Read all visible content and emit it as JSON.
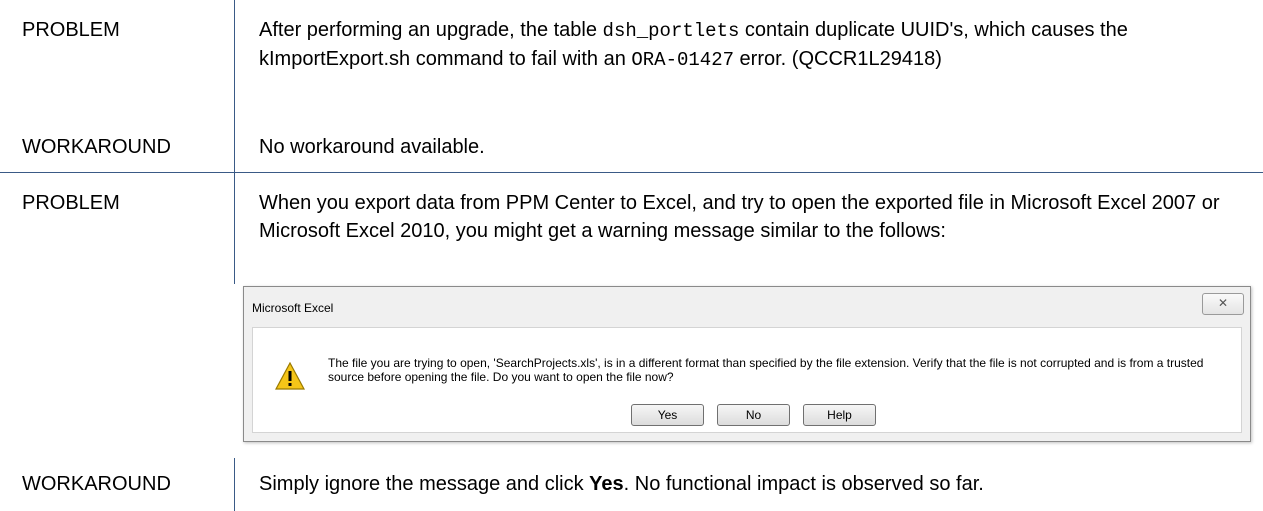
{
  "rows": [
    {
      "problem_label": "PROBLEM",
      "problem_text_1": "After performing an upgrade, the table ",
      "problem_code_1": "dsh_portlets",
      "problem_text_2": " contain duplicate UUID's, which causes the kImportExport.sh command to fail with an ",
      "problem_code_2": "ORA-01427",
      "problem_text_3": " error. (QCCR1L29418)",
      "workaround_label": "WORKAROUND",
      "workaround_text": "No workaround available."
    },
    {
      "problem_label": "PROBLEM",
      "problem_text": "When you export data from PPM Center to Excel, and try to open the exported file in Microsoft Excel 2007 or Microsoft Excel 2010, you might get a warning message similar to the follows:",
      "workaround_label": "WORKAROUND",
      "workaround_text_1": "Simply ignore the message and click ",
      "workaround_bold": "Yes",
      "workaround_text_2": ". No functional impact is observed so far."
    }
  ],
  "dialog": {
    "title": "Microsoft Excel",
    "close_glyph": "✕",
    "icon": "warning-icon",
    "message": "The file you are trying to open, 'SearchProjects.xls', is in a different format than specified by the file extension. Verify that the file is not corrupted and is from a trusted source before opening the file. Do you want to open the file now?",
    "buttons": [
      "Yes",
      "No",
      "Help"
    ]
  }
}
